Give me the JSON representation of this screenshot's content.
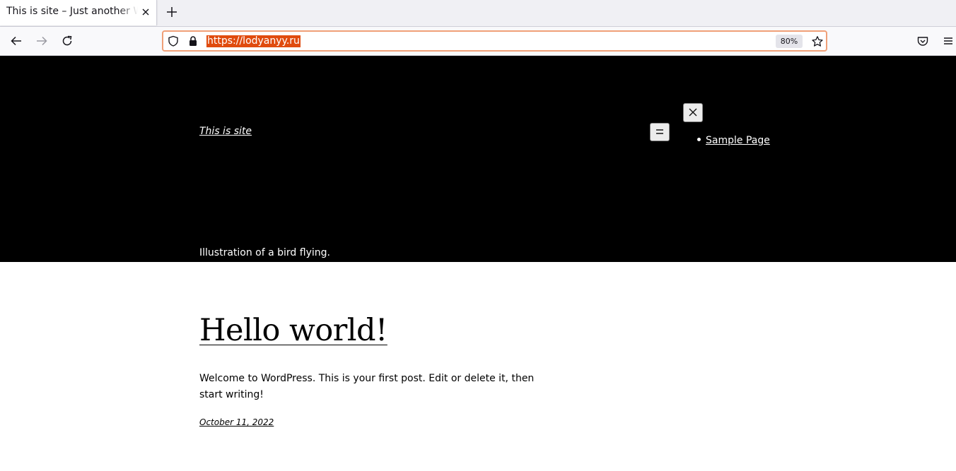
{
  "browser": {
    "tab": {
      "title": "This is site – Just another WordPress site"
    },
    "url": "https://lodyanyy.ru",
    "zoom": "80%",
    "icons": {
      "tab_close": "close-icon",
      "new_tab": "plus-icon",
      "back": "arrow-left-icon",
      "forward": "arrow-right-icon",
      "reload": "reload-icon",
      "tracking": "shield-icon",
      "secure": "lock-icon",
      "bookmark": "star-icon",
      "pocket": "pocket-icon",
      "menu": "hamburger-icon"
    },
    "colors": {
      "url_highlight": "#e04b0e",
      "url_focus_border": "#f0a078"
    }
  },
  "page": {
    "header": {
      "site_title": "This is site",
      "menu_open_label": "☰",
      "menu_close_label": "✕",
      "nav_items": [
        {
          "label": "Sample Page"
        }
      ],
      "hero_caption": "Illustration of a bird flying.",
      "background": "#000000"
    },
    "post": {
      "title": "Hello world!",
      "excerpt": "Welcome to WordPress. This is your first post. Edit or delete it, then start writing!",
      "date": "October 11, 2022"
    }
  }
}
